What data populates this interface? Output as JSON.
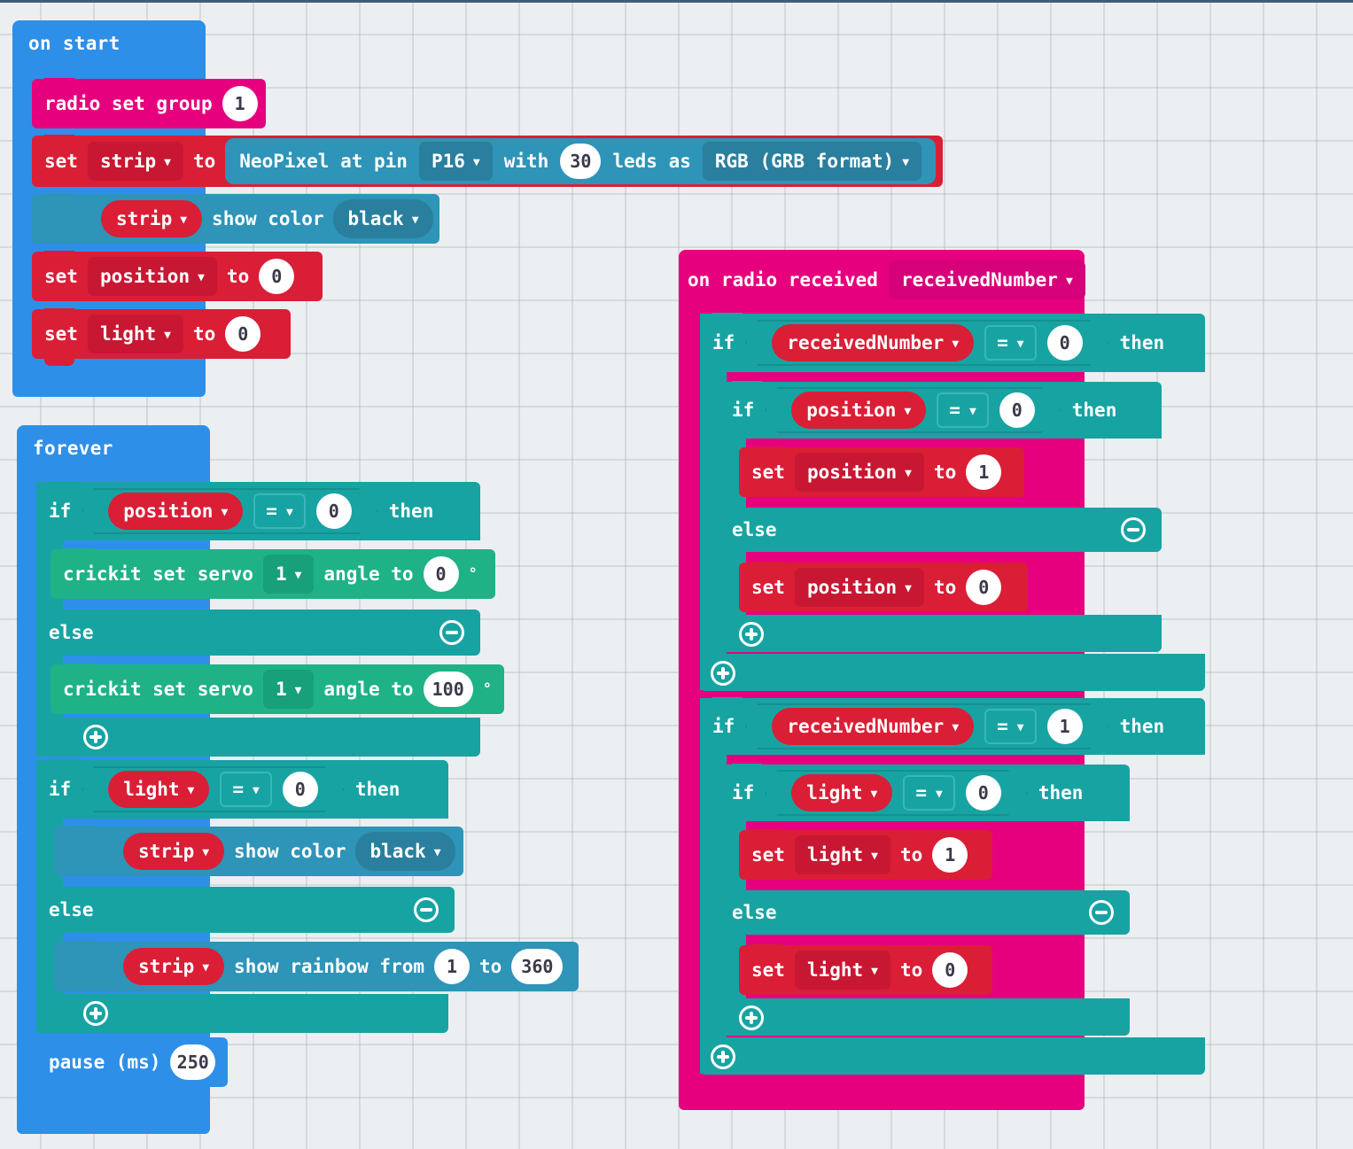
{
  "workspace": {
    "background_color": "#ECEFF1",
    "grid_dot": "+",
    "top_border_color": "#3F5C79"
  },
  "palette": {
    "loops": "#2E8FE8",
    "radio": "#E6007E",
    "variables": "#DA1E36",
    "neopixel": "#2E94B8",
    "logic": "#18A3A3",
    "crickit": "#1FB286"
  },
  "scripts": {
    "on_start": {
      "hat_label": "on start",
      "children": {
        "radio_set_group": {
          "label": "radio set group",
          "value": "1"
        },
        "set_strip": {
          "set_label": "set",
          "variable": "strip",
          "to_label": "to",
          "neopixel": {
            "prefix": "NeoPixel at pin",
            "pin": "P16",
            "with_label": "with",
            "leds": "30",
            "leds_label": "leds as",
            "format": "RGB (GRB format)"
          }
        },
        "strip_show_color": {
          "variable": "strip",
          "label": "show color",
          "color": "black"
        },
        "set_position": {
          "set_label": "set",
          "variable": "position",
          "to_label": "to",
          "value": "0"
        },
        "set_light": {
          "set_label": "set",
          "variable": "light",
          "to_label": "to",
          "value": "0"
        }
      }
    },
    "forever": {
      "hat_label": "forever",
      "if_position": {
        "if_label": "if",
        "variable": "position",
        "operator": "=",
        "value": "0",
        "then_label": "then",
        "else_label": "else",
        "then_body": {
          "label": "crickit set servo",
          "servo": "1",
          "angle_label": "angle to",
          "angle": "0",
          "degree": "°"
        },
        "else_body": {
          "label": "crickit set servo",
          "servo": "1",
          "angle_label": "angle to",
          "angle": "100",
          "degree": "°"
        }
      },
      "if_light": {
        "if_label": "if",
        "variable": "light",
        "operator": "=",
        "value": "0",
        "then_label": "then",
        "else_label": "else",
        "then_body": {
          "variable": "strip",
          "label": "show color",
          "color": "black"
        },
        "else_body": {
          "variable": "strip",
          "label": "show rainbow from",
          "from": "1",
          "to_label": "to",
          "to": "360"
        }
      },
      "pause": {
        "label": "pause (ms)",
        "value": "250"
      }
    },
    "on_radio_received": {
      "hat_label": "on radio received",
      "parameter": "receivedNumber",
      "if_received_zero": {
        "if_label": "if",
        "variable": "receivedNumber",
        "operator": "=",
        "value": "0",
        "then_label": "then",
        "inner_if": {
          "if_label": "if",
          "variable": "position",
          "operator": "=",
          "value": "0",
          "then_label": "then",
          "else_label": "else",
          "then_body": {
            "set_label": "set",
            "variable": "position",
            "to_label": "to",
            "value": "1"
          },
          "else_body": {
            "set_label": "set",
            "variable": "position",
            "to_label": "to",
            "value": "0"
          }
        }
      },
      "if_received_one": {
        "if_label": "if",
        "variable": "receivedNumber",
        "operator": "=",
        "value": "1",
        "then_label": "then",
        "inner_if": {
          "if_label": "if",
          "variable": "light",
          "operator": "=",
          "value": "0",
          "then_label": "then",
          "else_label": "else",
          "then_body": {
            "set_label": "set",
            "variable": "light",
            "to_label": "to",
            "value": "1"
          },
          "else_body": {
            "set_label": "set",
            "variable": "light",
            "to_label": "to",
            "value": "0"
          }
        }
      }
    }
  }
}
